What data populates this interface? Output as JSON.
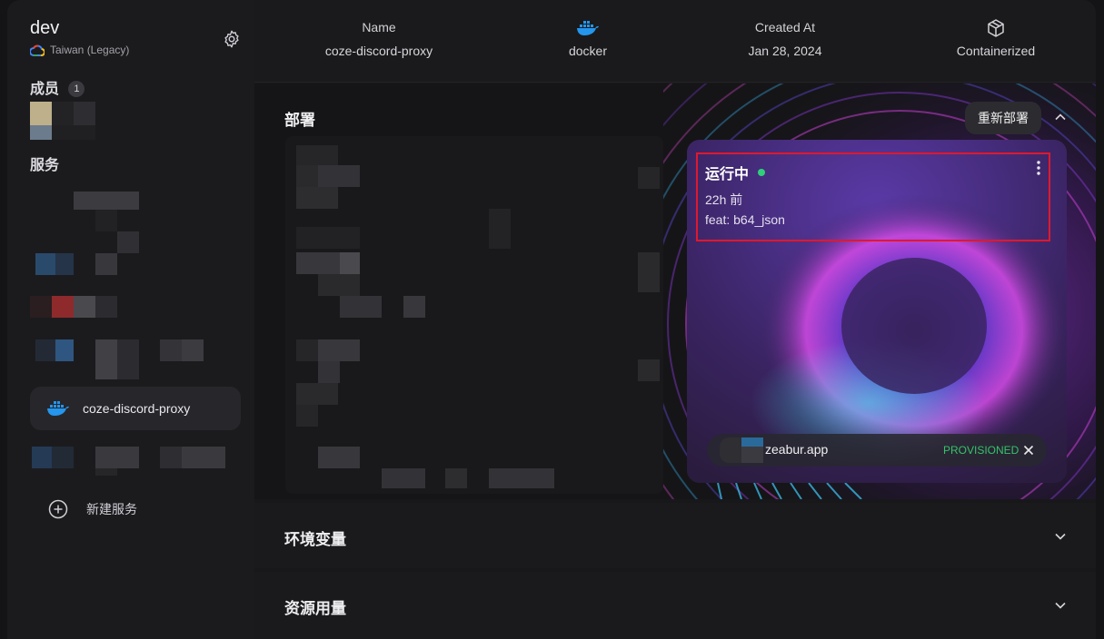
{
  "sidebar": {
    "project_name": "dev",
    "region": "Taiwan (Legacy)",
    "members_title": "成员",
    "members_count": "1",
    "services_title": "服务",
    "active_service": "coze-discord-proxy",
    "new_service_label": "新建服务"
  },
  "infobar": {
    "name_label": "Name",
    "name_value": "coze-discord-proxy",
    "docker_value": "docker",
    "created_label": "Created At",
    "created_value": "Jan 28, 2024",
    "container_value": "Containerized"
  },
  "deploy": {
    "title": "部署",
    "redeploy_label": "重新部署",
    "status": "运行中",
    "time": "22h 前",
    "commit": "feat: b64_json",
    "domain": "zeabur.app",
    "domain_status": "PROVISIONED"
  },
  "sections": {
    "env_title": "环境变量",
    "resource_title": "资源用量"
  },
  "colors": {
    "accent_green": "#35c36b",
    "highlight_red": "#e0182d",
    "docker_blue": "#2496ed"
  },
  "icons": [
    "gear-icon",
    "google-cloud-icon",
    "docker-icon",
    "cube-icon",
    "plus-circle-icon",
    "chevron-up-icon",
    "chevron-down-icon",
    "more-vertical-icon",
    "close-icon"
  ]
}
